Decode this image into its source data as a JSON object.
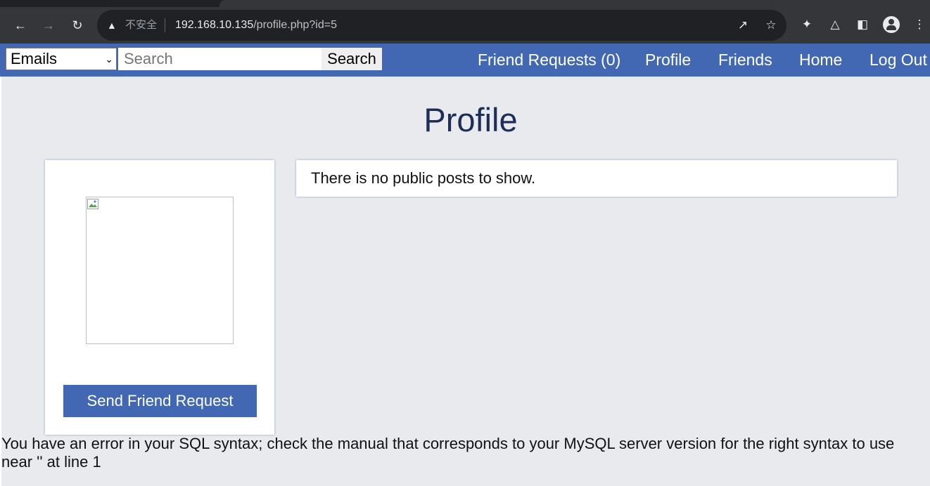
{
  "browser": {
    "insecure_label": "不安全",
    "url_host": "192.168.10.135",
    "url_path": "/profile.php?id=5"
  },
  "nav": {
    "select_value": "Emails",
    "search_placeholder": "Search",
    "search_button": "Search",
    "links": {
      "friend_requests": "Friend Requests (0)",
      "profile": "Profile",
      "friends": "Friends",
      "home": "Home",
      "logout": "Log Out"
    }
  },
  "page": {
    "title": "Profile",
    "send_friend_request": "Send Friend Request",
    "posts_message": "There is no public posts to show.",
    "sql_error": "You have an error in your SQL syntax; check the manual that corresponds to your MySQL server version for the right syntax to use near '' at line 1"
  },
  "colors": {
    "nav_bg": "#4268b4",
    "page_bg": "#e9eaee",
    "title_color": "#1d2f57"
  }
}
